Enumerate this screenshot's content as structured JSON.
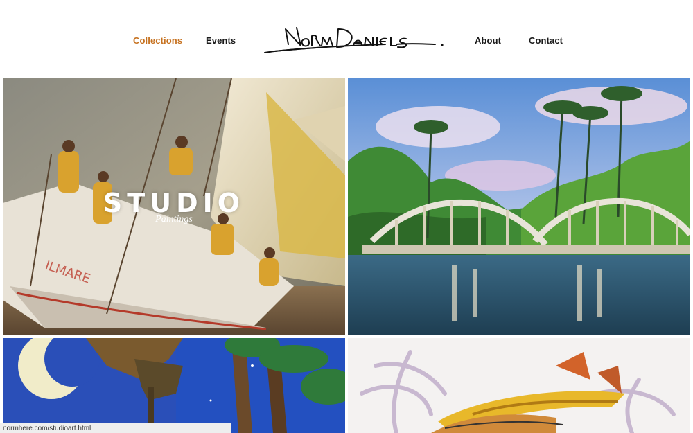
{
  "header": {
    "nav_left": [
      {
        "label": "Collections",
        "active": true
      },
      {
        "label": "Events",
        "active": false
      }
    ],
    "nav_right": [
      {
        "label": "About",
        "active": false
      },
      {
        "label": "Contact",
        "active": false
      }
    ],
    "logo_text": "Norm Daniels"
  },
  "colors": {
    "active_link": "#c6711f",
    "link": "#1a1a1a",
    "background": "#ffffff"
  },
  "gallery": {
    "tiles": [
      {
        "title": "STUDIO",
        "subtitle": "Paintings"
      },
      {
        "title": "",
        "subtitle": ""
      },
      {
        "title": "",
        "subtitle": ""
      },
      {
        "title": "",
        "subtitle": ""
      }
    ]
  },
  "status_bar": {
    "url": "normhere.com/studioart.html"
  }
}
